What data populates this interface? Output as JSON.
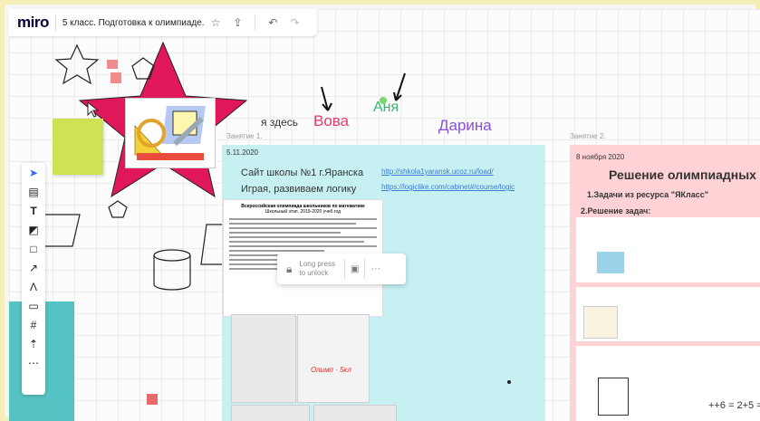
{
  "app": {
    "logo": "miro",
    "board_name": "5 класс. Подготовка к олимпиаде."
  },
  "toolbar": {
    "tools": [
      "cursor-icon",
      "frame-icon",
      "text-icon",
      "sticky-note-icon",
      "shape-icon",
      "arrow-icon",
      "pen-icon",
      "comment-icon",
      "crop-frame-icon",
      "upload-icon",
      "more-icon"
    ]
  },
  "canvas_labels": {
    "ya_zdes": "я здесь",
    "vova": "Вова",
    "anya": "Аня",
    "darina": "Дарина",
    "frame1_title": "Занятие 1.",
    "frame2_title": "Занятие 2."
  },
  "colors": {
    "vova": "#e8386c",
    "anya": "#3cb371",
    "darina": "#8a4fd6",
    "star": "#e0185a",
    "frame1_bg": "#c7f0f2",
    "frame2_bg": "#ffd3d6"
  },
  "frame1": {
    "date": "5.11.2020",
    "site_title": "Сайт школы №1 г.Яранска",
    "subtitle": "Играя, развиваем логику",
    "link1": "http://shkola1yaransk.ucoz.ru/load/",
    "link2": "https://logiclike.com/cabinet#/course/logic",
    "doc_title": "Всероссийская олимпиада школьников по математике",
    "doc_subtitle": "Школьный этап. 2019-2020 учеб.год",
    "photo_text": "Олимп · 5кл"
  },
  "popup": {
    "text_line1": "Long press",
    "text_line2": "to unlock",
    "more": "···"
  },
  "frame2": {
    "date": "8 ноября 2020",
    "title": "Решение олимпиадных зада",
    "item1": "1.Задачи из ресурса \"ЯКласс\"",
    "item2": "2.Решение задач:",
    "equation": "++6 = 2+5 ="
  }
}
